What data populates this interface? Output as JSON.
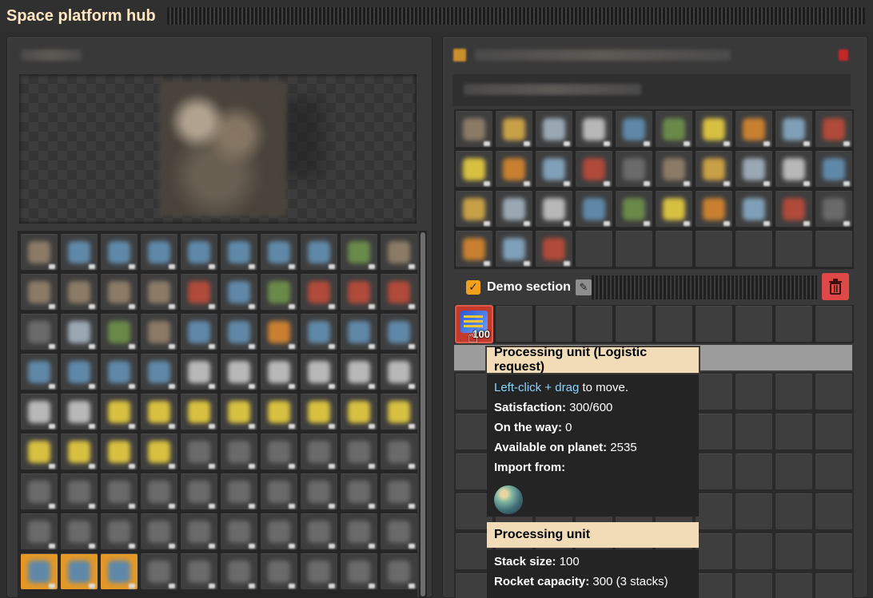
{
  "window": {
    "title": "Space platform hub"
  },
  "section": {
    "label": "Demo section",
    "checked": true,
    "slot_count": "100"
  },
  "tooltip": {
    "title": "Processing unit (Logistic request)",
    "hint_action": "Left-click + drag",
    "hint_rest": " to move.",
    "satisfaction_label": "Satisfaction:",
    "satisfaction_value": " 300/600",
    "on_the_way_label": "On the way:",
    "on_the_way_value": " 0",
    "available_label": "Available on planet:",
    "available_value": " 2535",
    "import_label": "Import from:",
    "import_icon": "planet-icon",
    "item_title": "Processing unit",
    "stack_label": "Stack size:",
    "stack_value": " 100",
    "rocket_label": "Rocket capacity:",
    "rocket_value": " 300 (3 stacks)"
  },
  "colors": {
    "accent_orange": "#f0a01c",
    "tooltip_header": "#f1dcb7",
    "delete_red": "#e04848",
    "hint_blue": "#8ad4ff"
  }
}
